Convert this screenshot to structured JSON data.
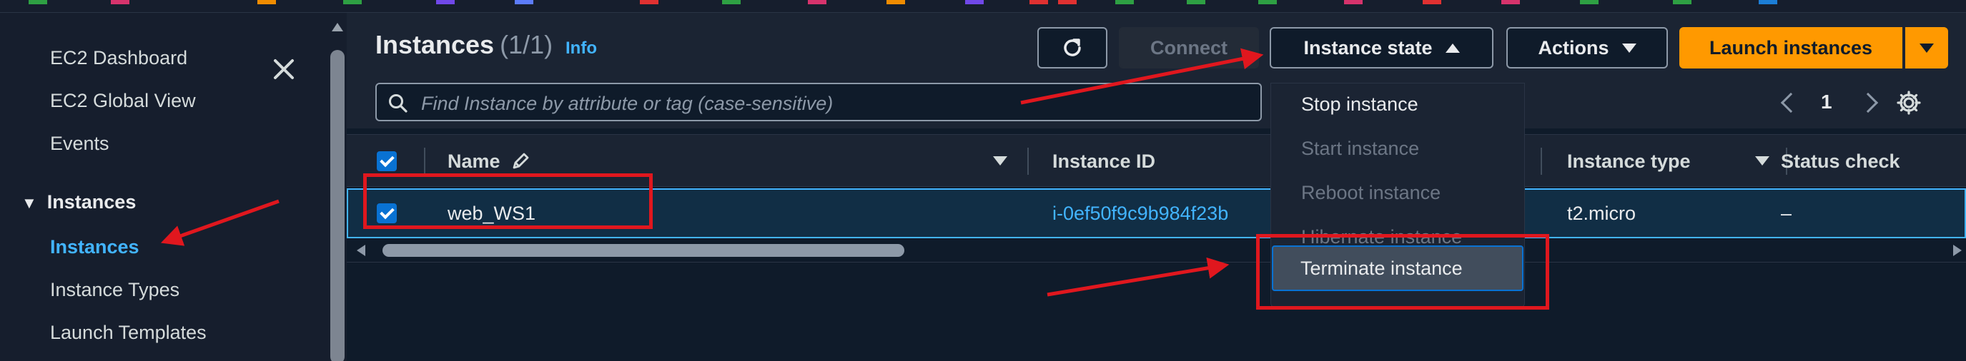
{
  "colors": {
    "page_bg": "#0f1b2a",
    "panel_bg": "#1b2433",
    "sidebar_bg": "#161e2d",
    "accent_link": "#42b4ff",
    "primary_button": "#ff9900",
    "checkbox": "#0972d3",
    "annotation_red": "#e0171e"
  },
  "top_strip": {
    "swatches": [
      "#2ea043",
      "#d6336c",
      "#f08c00",
      "#2ea043",
      "#7048e8",
      "#5c7cfa",
      "#e03131",
      "#2ea043",
      "#d6336c",
      "#f08c00",
      "#7048e8",
      "#e03131",
      "#e03131",
      "#2ea043",
      "#2ea043",
      "#2ea043",
      "#d6336c",
      "#e03131",
      "#d6336c",
      "#2ea043",
      "#2ea043",
      "#1c7ed6"
    ]
  },
  "sidebar": {
    "close_icon": "close-icon",
    "items_top": [
      "EC2 Dashboard",
      "EC2 Global View",
      "Events"
    ],
    "section_title": "Instances",
    "section_items": [
      "Instances",
      "Instance Types",
      "Launch Templates"
    ],
    "active_item": "Instances"
  },
  "header": {
    "title": "Instances",
    "count": "(1/1)",
    "info_link": "Info",
    "refresh_icon": "refresh-icon",
    "connect_label": "Connect",
    "instance_state_label": "Instance state",
    "actions_label": "Actions",
    "launch_label": "Launch instances"
  },
  "search": {
    "placeholder": "Find Instance by attribute or tag (case-sensitive)",
    "icon": "search-icon"
  },
  "pagination": {
    "current_page": "1",
    "prev_icon": "chevron-left-icon",
    "next_icon": "chevron-right-icon",
    "settings_icon": "gear-icon"
  },
  "table": {
    "columns": [
      "Name",
      "Instance ID",
      "Instance type",
      "Status check"
    ],
    "rows": [
      {
        "selected": true,
        "name": "web_WS1",
        "instance_id": "i-0ef50f9c9b984f23b",
        "instance_type": "t2.micro",
        "status_check": "–"
      }
    ]
  },
  "instance_state_menu": {
    "items": [
      {
        "label": "Stop instance",
        "enabled": true
      },
      {
        "label": "Start instance",
        "enabled": false
      },
      {
        "label": "Reboot instance",
        "enabled": false
      },
      {
        "label": "Hibernate instance",
        "enabled": false
      },
      {
        "label": "Terminate instance",
        "enabled": true,
        "highlighted": true
      }
    ]
  }
}
